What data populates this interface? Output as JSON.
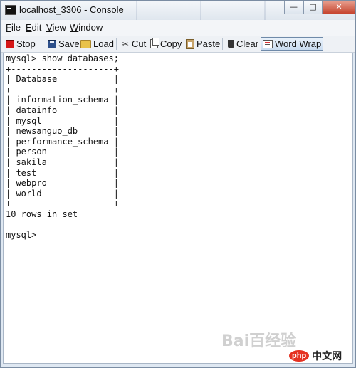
{
  "window": {
    "title": "localhost_3306 - Console",
    "controls": {
      "minimize": "—",
      "maximize": "□",
      "close": "✕"
    }
  },
  "menu": {
    "items": [
      {
        "key": "F",
        "rest": "ile"
      },
      {
        "key": "E",
        "rest": "dit"
      },
      {
        "key": "V",
        "rest": "iew"
      },
      {
        "key": "W",
        "rest": "indow"
      }
    ]
  },
  "toolbar": {
    "stop": {
      "label": "Stop",
      "icon": "stop-icon"
    },
    "save": {
      "label": "Save",
      "icon": "save-icon"
    },
    "load": {
      "label": "Load",
      "icon": "folder-icon"
    },
    "cut": {
      "label": "Cut",
      "icon": "scissors-icon"
    },
    "copy": {
      "label": "Copy",
      "icon": "copy-icon"
    },
    "paste": {
      "label": "Paste",
      "icon": "paste-icon"
    },
    "clear": {
      "label": "Clear",
      "icon": "trash-icon"
    },
    "word_wrap": {
      "label": "Word Wrap",
      "icon": "word-wrap-icon",
      "active": true
    }
  },
  "console": {
    "lines": [
      "mysql> show databases;",
      "+--------------------+",
      "| Database           |",
      "+--------------------+",
      "| information_schema |",
      "| datainfo           |",
      "| mysql              |",
      "| newsanguo_db       |",
      "| performance_schema |",
      "| person             |",
      "| sakila             |",
      "| test               |",
      "| webpro             |",
      "| world              |",
      "+--------------------+",
      "10 rows in set",
      "",
      "mysql>"
    ]
  },
  "watermark": {
    "baidu": "Bai百经验",
    "php_badge": "php",
    "cn": "中文网"
  },
  "colors": {
    "close_button": "#c6452f",
    "stop_icon": "#d51616",
    "console_bg": "#ffffff"
  }
}
